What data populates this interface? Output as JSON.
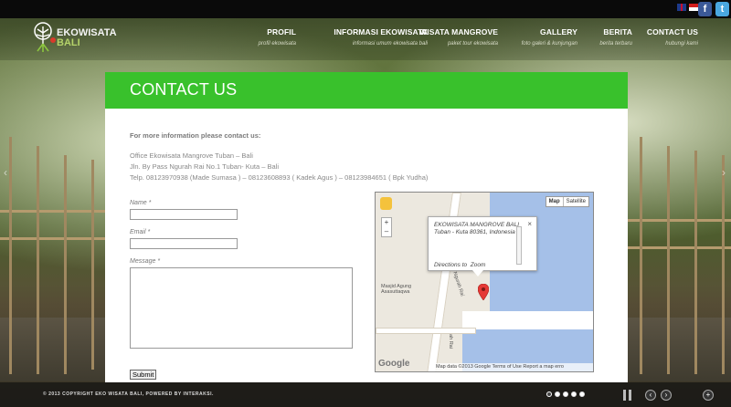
{
  "lang_flags": [
    "uk-flag-icon",
    "indonesia-flag-icon"
  ],
  "social": {
    "facebook": "f",
    "twitter": "t"
  },
  "logo": {
    "line1": "EKOWISATA",
    "line2": "BALI"
  },
  "nav": [
    {
      "title": "PROFIL",
      "sub": "profil ekowisata"
    },
    {
      "title": "INFORMASI EKOWISATA",
      "sub": "informasi umum ekowisata bali"
    },
    {
      "title": "WISATA MANGROVE",
      "sub": "paket tour ekowisata"
    },
    {
      "title": "GALLERY",
      "sub": "foto galeri & kunjungan"
    },
    {
      "title": "BERITA",
      "sub": "berita terbaru"
    },
    {
      "title": "CONTACT US",
      "sub": "hubungi kami"
    }
  ],
  "page": {
    "title": "CONTACT US"
  },
  "intro": {
    "heading": "For more information please contact us:",
    "office": "Office Ekowisata Mangrove Tuban – Bali",
    "address": "Jln. By Pass Ngurah Rai No.1 Tuban- Kuta – Bali",
    "telp": "Telp.   08123970938  (Made Sumasa ) – 08123608893 ( Kadek Agus ) – 08123984651 ( Bpk Yudha)"
  },
  "form": {
    "name_label": "Name",
    "email_label": "Email",
    "message_label": "Message",
    "required_mark": "*",
    "submit_label": "Submit"
  },
  "map": {
    "type_map": "Map",
    "type_satellite": "Satellite",
    "zoom_in": "+",
    "zoom_out": "–",
    "info_name": "EKOWISATA MANGROVE BALI",
    "info_address": "Tuban - Kuta 80361, Indonesia",
    "info_directions": "Directions to",
    "info_zoom": "Zoom",
    "info_close": "×",
    "label_mosque": "Masjid Agung Asasuttaqwa",
    "label_road": "Jl. Ngurah Rai",
    "label_road2": "ah Rai",
    "google": "Google",
    "footer": "Map data ©2013 Google   Terms of Use   Report a map erro"
  },
  "footer": {
    "copyright": "© 2013 COPYRIGHT EKO WISATA BALI, POWERED BY INTERAKSI.",
    "dots": 5,
    "active_dot": 0,
    "prev": "‹",
    "next": "›",
    "expand": "+"
  }
}
